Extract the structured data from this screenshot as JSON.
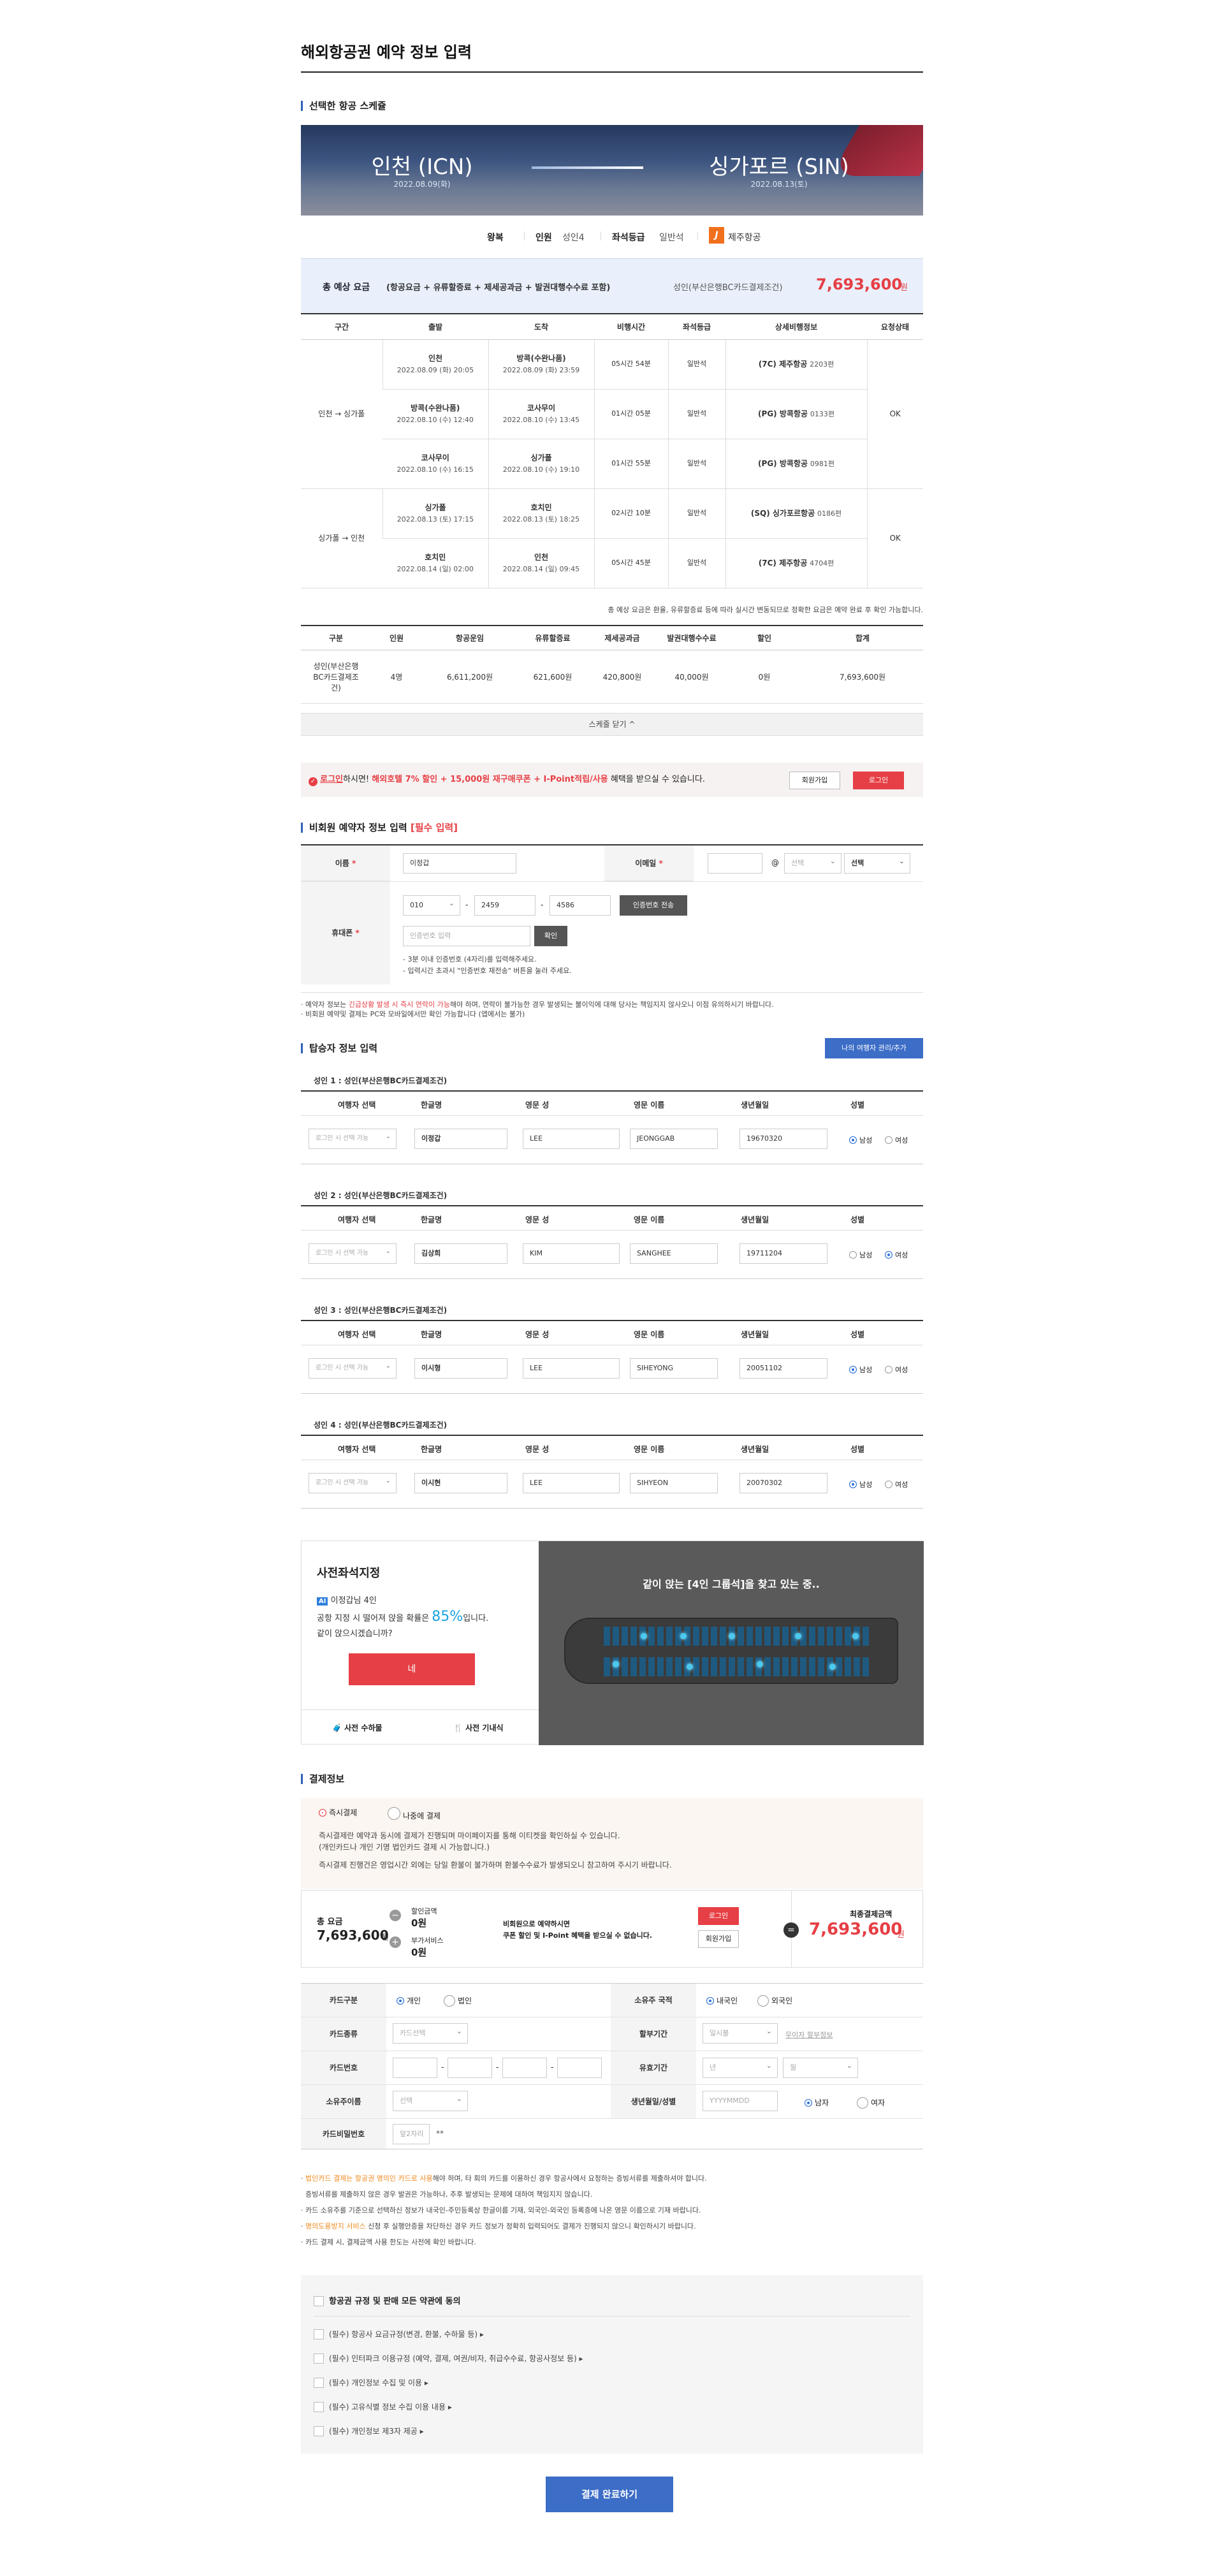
{
  "page": {
    "title": "해외항공권 예약 정보 입력"
  },
  "schedule": {
    "section_title": "선택한 항공 스케쥴",
    "from_city": "인천 (ICN)",
    "from_date": "2022.08.09(화)",
    "to_city": "싱가포르 (SIN)",
    "to_date": "2022.08.13(토)",
    "trip_type": "왕복",
    "pax_label": "인원",
    "pax_value": "성인4",
    "seat_label": "좌석등급",
    "seat_value": "일반석",
    "airline": "제주항공"
  },
  "fare": {
    "label": "총 예상 요금",
    "detail": "(항공요금 + 유류할증료 + 제세공과금 + 발권대행수수료 포함)",
    "condition": "성인(부산은행BC카드결제조건)",
    "amount": "7,693,600",
    "unit": "원"
  },
  "itinerary": {
    "headers": [
      "구간",
      "출발",
      "도착",
      "비행시간",
      "좌석등급",
      "상세비행정보",
      "요청상태"
    ],
    "seg1": "인천 → 싱가폴",
    "seg2": "싱가폴 → 인천",
    "status1": "OK",
    "status2": "OK",
    "rows": [
      {
        "dep": "인천",
        "dep_time": "2022.08.09 (화) 20:05",
        "arr": "방콕(수완나품)",
        "arr_time": "2022.08.09 (화) 23:59",
        "dur": "05시간 54분",
        "cls": "일반석",
        "flight": "(7C) 제주항공",
        "no": "2203편"
      },
      {
        "dep": "방콕(수완나품)",
        "dep_time": "2022.08.10 (수) 12:40",
        "arr": "코사무이",
        "arr_time": "2022.08.10 (수) 13:45",
        "dur": "01시간 05분",
        "cls": "일반석",
        "flight": "(PG) 방콕항공",
        "no": "0133편"
      },
      {
        "dep": "코사무이",
        "dep_time": "2022.08.10 (수) 16:15",
        "arr": "싱가폴",
        "arr_time": "2022.08.10 (수) 19:10",
        "dur": "01시간 55분",
        "cls": "일반석",
        "flight": "(PG) 방콕항공",
        "no": "0981편"
      },
      {
        "dep": "싱가폴",
        "dep_time": "2022.08.13 (토) 17:15",
        "arr": "호치민",
        "arr_time": "2022.08.13 (토) 18:25",
        "dur": "02시간 10분",
        "cls": "일반석",
        "flight": "(SQ) 싱가포르항공",
        "no": "0186편"
      },
      {
        "dep": "호치민",
        "dep_time": "2022.08.14 (일) 02:00",
        "arr": "인천",
        "arr_time": "2022.08.14 (일) 09:45",
        "dur": "05시간 45분",
        "cls": "일반석",
        "flight": "(7C) 제주항공",
        "no": "4704편"
      }
    ],
    "note": "총 예상 요금은 환율, 유류할증료 등에 따라 실시간 변동되므로 정확한 요금은 예약 완료 후 확인 가능합니다."
  },
  "price_table": {
    "headers": [
      "구분",
      "인원",
      "항공운임",
      "유류할증료",
      "제세공과금",
      "발권대행수수료",
      "할인",
      "합계"
    ],
    "row": [
      "성인(부산은행BC카드결제조건)",
      "4명",
      "6,611,200원",
      "621,600원",
      "420,800원",
      "40,000원",
      "0원",
      "7,693,600원"
    ],
    "close": "스케줄 닫기 ^"
  },
  "login_bar": {
    "link": "로그인",
    "text1": "하시면!",
    "benefit": "해외호텔 7% 할인 + 15,000원 재구매쿠폰 + I-Point적립/사용",
    "text2": "혜택을 받으실 수 있습니다.",
    "join": "회원가입",
    "login": "로그인"
  },
  "booker": {
    "title": "비회원 예약자 정보 입력",
    "required": "[필수 입력]",
    "name_label": "이름",
    "name_value": "이정갑",
    "email_label": "이메일",
    "at": "@",
    "email_select": "선택",
    "email_select2": "선택",
    "phone_label": "휴대폰",
    "phone1": "010",
    "phone2": "2459",
    "phone3": "4586",
    "send_btn": "인증번호 전송",
    "code_placeholder": "인증번호 입력",
    "confirm_btn": "확인",
    "tip1": "- 3분 이내 인증번호 (4자리)를 입력해주세요.",
    "tip2": "- 입력시간 초과시 \"인증번호 재전송\" 버튼을 눌러 주세요.",
    "notice1a": "예약자 정보는",
    "notice1b": "긴급상황 발생 시 즉시 연락이 가능",
    "notice1c": "해야 하며, 연락이 불가능한 경우 발생되는 불이익에 대해 당사는 책임지지 않사오니 이점 유의하시기 바랍니다.",
    "notice2": "비회원 예약및 결제는 PC와 모바일에서만 확인 가능합니다 (앱에서는 불가)"
  },
  "passengers": {
    "title": "탑승자 정보 입력",
    "manage_btn": "나의 여행자 관리/추가",
    "headers": [
      "여행자 선택",
      "한글명",
      "영문 성",
      "영문 이름",
      "생년월일",
      "성별"
    ],
    "select_placeholder": "로그인 시 선택 가능",
    "male": "남성",
    "female": "여성",
    "list": [
      {
        "title": "성인 1 : 성인(부산은행BC카드결제조건)",
        "kname": "이정갑",
        "last": "LEE",
        "first": "JEONGGAB",
        "birth": "19670320",
        "gender": "male"
      },
      {
        "title": "성인 2 : 성인(부산은행BC카드결제조건)",
        "kname": "김상희",
        "last": "KIM",
        "first": "SANGHEE",
        "birth": "19711204",
        "gender": "female"
      },
      {
        "title": "성인 3 : 성인(부산은행BC카드결제조건)",
        "kname": "이시형",
        "last": "LEE",
        "first": "SIHEYONG",
        "birth": "20051102",
        "gender": "male"
      },
      {
        "title": "성인 4 : 성인(부산은행BC카드결제조건)",
        "kname": "이시현",
        "last": "LEE",
        "first": "SIHYEON",
        "birth": "20070302",
        "gender": "male"
      }
    ]
  },
  "seat": {
    "title": "사전좌석지정",
    "ai": "AI",
    "line1": "이정갑님 4인",
    "line2a": "공항 지정 시 떨어져 앉을 확률은",
    "percent": "85%",
    "line2b": "입니다.",
    "line3": "같이 앉으시겠습니까?",
    "yes_btn": "네",
    "left_tab": "사전 수하물",
    "right_tab": "사전 기내식",
    "searching": "같이 앉는 [4인 그룹석]을 찾고 있는 중.."
  },
  "payment": {
    "title": "결제정보",
    "opt1": "즉시결제",
    "opt2": "나중에 결제",
    "desc1": "즉시결제란 예약과 동시에 결제가 진행되며 마이페이지를 통해 이티켓을 확인하실 수 있습니다.",
    "desc2": "(개인카드나 개인 기명 법인카드 결제 시 가능합니다.)",
    "desc3": "즉시결제 진행건은 영업시간 외에는 당일 환불이 불가하며 환불수수료가 발생되오니 참고하여 주시기 바랍니다.",
    "total_label": "총 요금",
    "total_value": "7,693,600",
    "won": "원",
    "discount_label": "할인금액",
    "discount_value": "0원",
    "service_label": "부가서비스",
    "service_value": "0원",
    "member_msg1": "비회원으로 예약하시면",
    "member_msg2": "쿠폰 할인 및 I-Point 혜택을 받으실 수 없습니다.",
    "login": "로그인",
    "join": "회원가입",
    "final_label": "최종결제금액",
    "final_value": "7,693,600",
    "final_unit": "원"
  },
  "card": {
    "type_label": "카드구분",
    "type1": "개인",
    "type2": "법인",
    "nation_label": "소유주 국적",
    "nation1": "내국인",
    "nation2": "외국인",
    "kind_label": "카드종류",
    "kind_select": "카드선택",
    "install_label": "할부기간",
    "install_select": "일시불",
    "install_info": "무이자 할부정보",
    "number_label": "카드번호",
    "dash": "-",
    "expiry_label": "유효기간",
    "year": "년",
    "month": "월",
    "owner_label": "소유주이름",
    "owner_select": "선택",
    "birth_label": "생년월일/성별",
    "birth_placeholder": "YYYYMMDD",
    "male": "남자",
    "female": "여자",
    "pw_label": "카드비밀번호",
    "pw_placeholder": "앞2자리",
    "pw_mask": "**"
  },
  "card_notes": [
    {
      "hl": "법인카드",
      "a": "결제는 항공권 명의인 카드로 사용",
      "b": "해야 하며, 타 회의 카드를 이용하신 경우 항공사에서 요청하는 증빙서류를 제출하셔야 합니다."
    },
    {
      "hl": "",
      "a": "",
      "b": "증빙서류를 제출하지 않은 경우 발권은 가능하나, 추후 발생되는 문제에 대하여 책임지지 않습니다."
    },
    {
      "hl": "",
      "a": "",
      "b": "카드 소유주를 기준으로 선택하신 정보가 내국인-주민등록상 한글이름 기재, 외국인-외국인 등록증에 나온 영문 이름으로 기재 바랍니다."
    },
    {
      "hl": "명의도용방지 서비스",
      "a": "",
      "b": "신청 후 실행안증을 차단하신 경우 카드 정보가 정확히 입력되어도 결제가 진행되지 않으니 확인하시기 바랍니다."
    },
    {
      "hl": "",
      "a": "",
      "b": "카드 결제 시, 결제금액 사용 한도는 사전에 확인 바랍니다."
    }
  ],
  "agree": {
    "all": "항공권 규정 및 판매 모든 약관에 동의",
    "items": [
      "(필수) 항공사 요금규정(변경, 환불, 수하물 등)",
      "(필수) 인터파크 이용규정 (예약, 결제, 여권/비자, 취급수수료, 항공사정보 등)",
      "(필수) 개인정보 수집 및 이용",
      "(필수) 고유식별 정보 수집 이용 내용",
      "(필수) 개인정보 제3자 제공"
    ]
  },
  "submit": "결제 완료하기",
  "colors": {
    "brand": "#3c6dc7",
    "accent_red": "#e63f45",
    "jeju_orange": "#f0701e"
  }
}
